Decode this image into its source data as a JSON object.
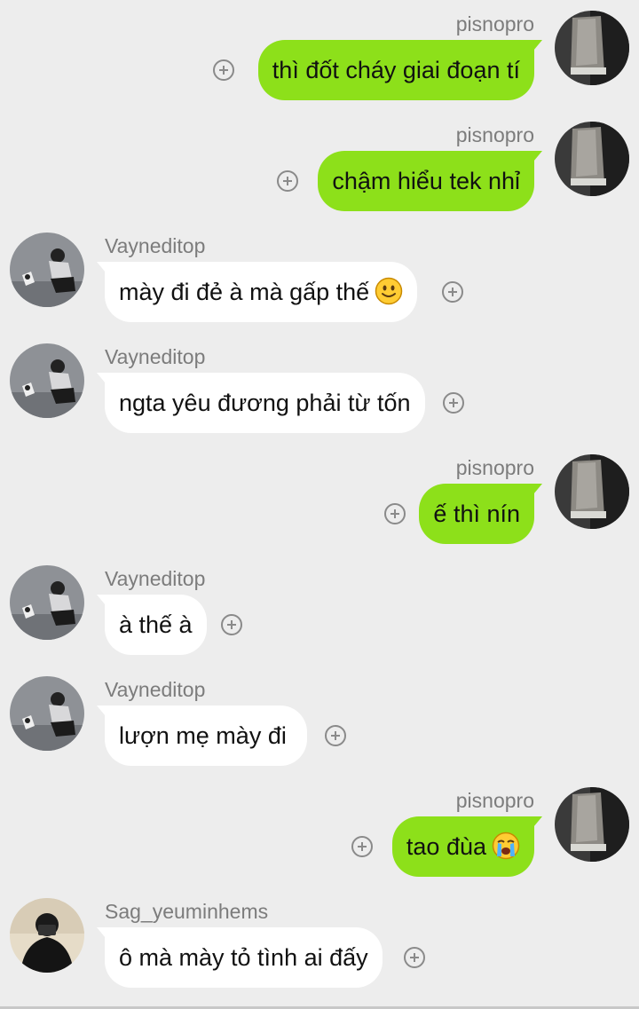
{
  "messages": [
    {
      "direction": "out",
      "sender": "pisnopro",
      "text": "thì đốt cháy giai đoạn tí",
      "emoji": ""
    },
    {
      "direction": "out",
      "sender": "pisnopro",
      "text": "chậm hiểu tek nhỉ",
      "emoji": ""
    },
    {
      "direction": "in",
      "sender": "Vayneditop",
      "text": "mày đi đẻ à mà gấp thế",
      "emoji": "slightly-smiling-face"
    },
    {
      "direction": "in",
      "sender": "Vayneditop",
      "text": "ngta yêu đương phải từ tốn",
      "emoji": ""
    },
    {
      "direction": "out",
      "sender": "pisnopro",
      "text": "ế thì nín",
      "emoji": ""
    },
    {
      "direction": "in",
      "sender": "Vayneditop",
      "text": "à thế à",
      "emoji": ""
    },
    {
      "direction": "in",
      "sender": "Vayneditop",
      "text": "lượn mẹ mày đi ",
      "emoji": ""
    },
    {
      "direction": "out",
      "sender": "pisnopro",
      "text": "tao đùa",
      "emoji": "loudly-crying-face"
    },
    {
      "direction": "in",
      "sender": "Sag_yeuminhems",
      "text": "ô mà mày tỏ tình ai đấy",
      "emoji": ""
    }
  ],
  "colors": {
    "background": "#ededed",
    "outgoing_bubble": "#8de01a",
    "incoming_bubble": "#ffffff",
    "sender_name": "#7c7c7c"
  }
}
